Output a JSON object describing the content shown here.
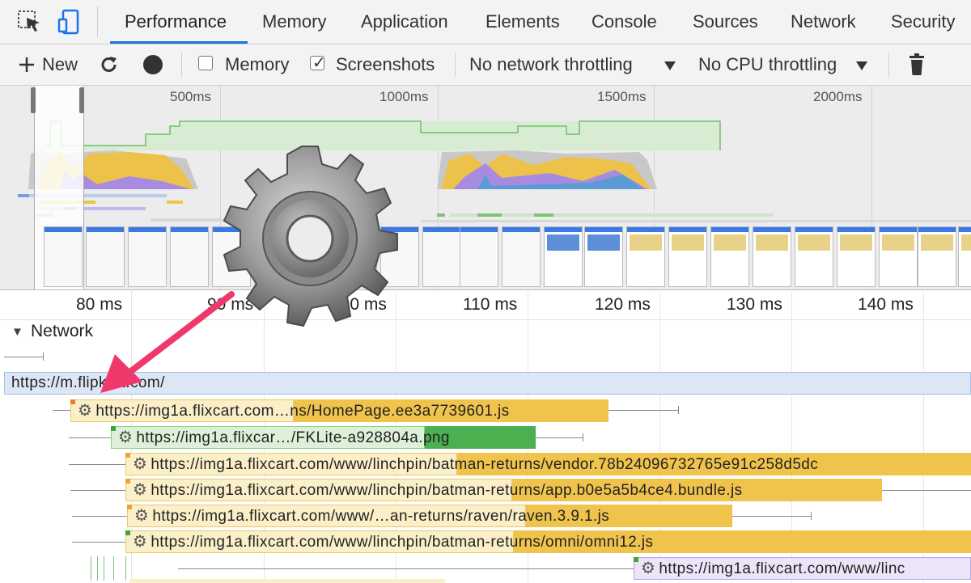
{
  "tabs": {
    "items": [
      "Performance",
      "Memory",
      "Application",
      "Elements",
      "Console",
      "Sources",
      "Network",
      "Security"
    ],
    "active": "Performance",
    "icons": [
      "inspect-element-icon",
      "device-toolbar-icon"
    ]
  },
  "toolbar": {
    "new_label": "New",
    "memory_label": "Memory",
    "memory_checked": false,
    "screenshots_label": "Screenshots",
    "screenshots_checked": true,
    "network_throttle": "No network throttling",
    "cpu_throttle": "No CPU throttling",
    "icons": [
      "plus-icon",
      "reload-icon",
      "record-icon",
      "trash-icon",
      "dropdown-arrow-icon"
    ]
  },
  "overview": {
    "time_marks": [
      "500ms",
      "1000ms",
      "1500ms",
      "2000ms"
    ]
  },
  "ruler": {
    "ticks": [
      "80 ms",
      "90 ms",
      "100 ms",
      "110 ms",
      "120 ms",
      "130 ms",
      "140 ms"
    ]
  },
  "network": {
    "section_label": "Network",
    "rows": [
      "https://m.flipkart.com/",
      "https://img1a.flixcart.com…ns/HomePage.ee3a7739601.js",
      "https://img1a.flixcar…/FKLite-a928804a.png",
      "https://img1a.flixcart.com/www/linchpin/batman-returns/vendor.78b24096732765e91c258d5dc",
      "https://img1a.flixcart.com/www/linchpin/batman-returns/app.b0e5a5b4ce4.bundle.js",
      "https://img1a.flixcart.com/www/…an-returns/raven/raven.3.9.1.js",
      "https://img1a.flixcart.com/www/linchpin/batman-returns/omni/omni12.js",
      "https://img1a.flixcart.com/www/linc"
    ]
  },
  "overlay": {
    "icons": [
      "settings-gear-icon",
      "pink-arrow-icon"
    ]
  },
  "colors": {
    "accent": "#1a73e8",
    "script_bar": "#f0c44c",
    "script_bar_light": "#fbefc8",
    "image_bar": "#4caf50",
    "image_bar_light": "#dff0d8",
    "document_bar": "#dce6f5",
    "arrow": "#f0386b"
  }
}
